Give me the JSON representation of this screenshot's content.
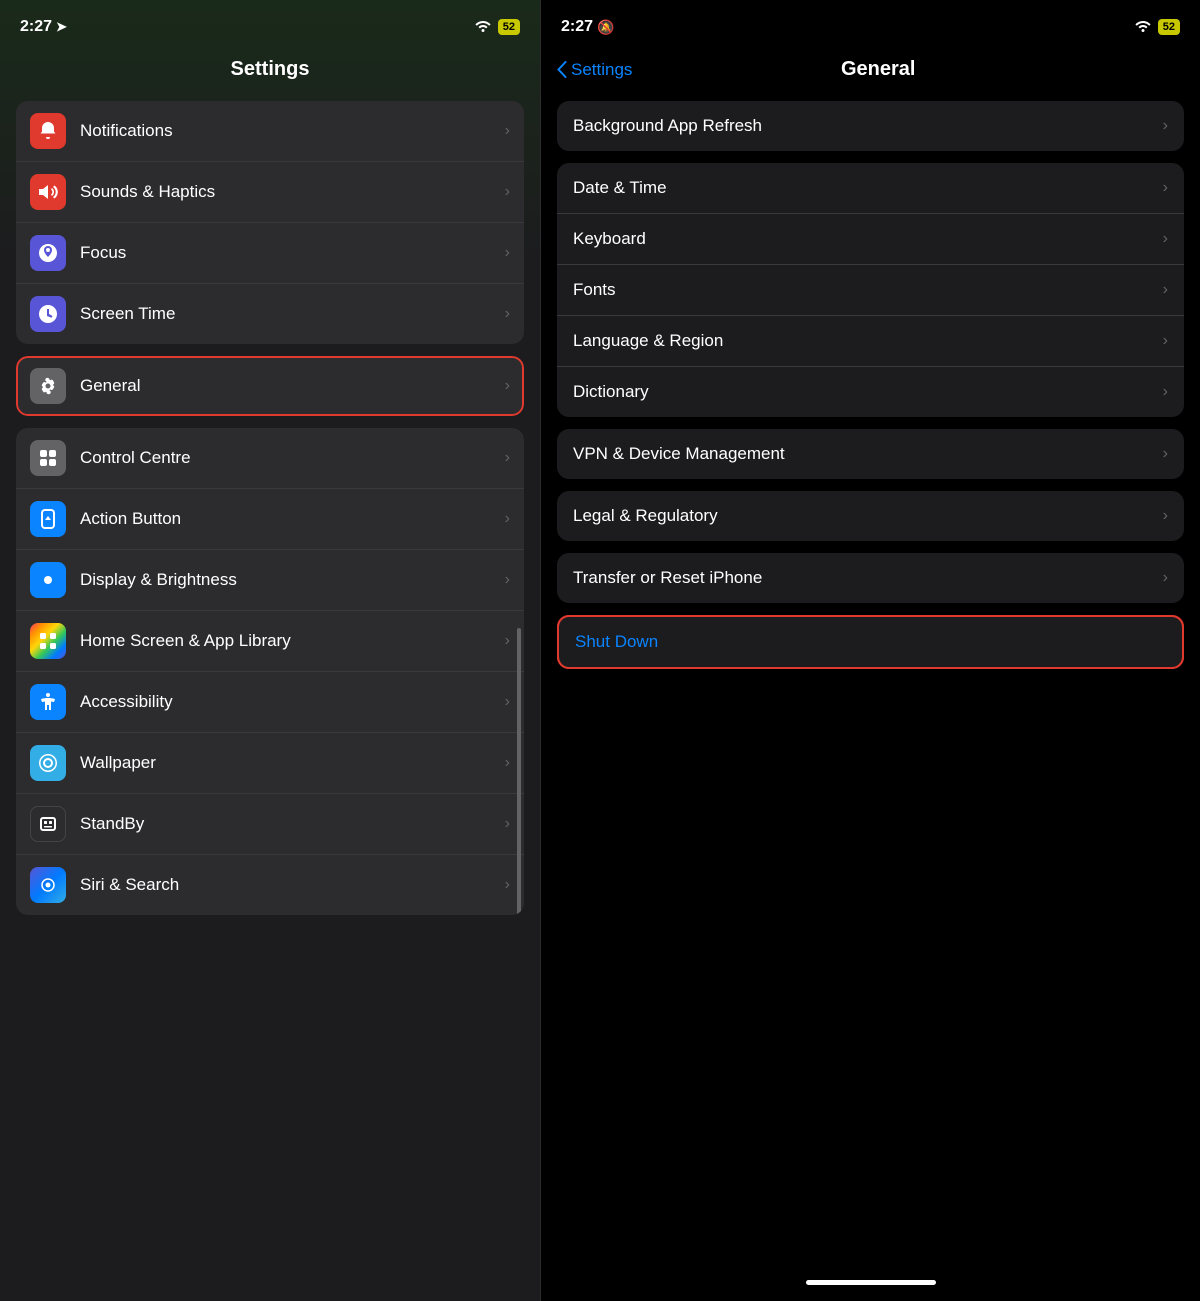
{
  "left": {
    "statusBar": {
      "time": "2:27",
      "wifi": "wifi",
      "battery": "52"
    },
    "title": "Settings",
    "groups": [
      {
        "id": "group1",
        "items": [
          {
            "id": "notifications",
            "label": "Notifications",
            "iconClass": "icon-red",
            "icon": "🔔"
          },
          {
            "id": "sounds",
            "label": "Sounds & Haptics",
            "iconClass": "icon-soundshaptics",
            "icon": "🔊"
          },
          {
            "id": "focus",
            "label": "Focus",
            "iconClass": "icon-indigo",
            "icon": "🌙"
          },
          {
            "id": "screen-time",
            "label": "Screen Time",
            "iconClass": "icon-indigo",
            "icon": "⏳"
          }
        ]
      },
      {
        "id": "group2",
        "items": [
          {
            "id": "general",
            "label": "General",
            "iconClass": "icon-gray",
            "icon": "⚙️",
            "highlighted": true
          }
        ]
      },
      {
        "id": "group3",
        "items": [
          {
            "id": "control-centre",
            "label": "Control Centre",
            "iconClass": "icon-gray",
            "icon": "☰"
          },
          {
            "id": "action-button",
            "label": "Action Button",
            "iconClass": "icon-blue",
            "icon": "↗"
          },
          {
            "id": "display-brightness",
            "label": "Display & Brightness",
            "iconClass": "icon-blue",
            "icon": "☀"
          },
          {
            "id": "home-screen",
            "label": "Home Screen & App Library",
            "iconClass": "icon-multicolor",
            "icon": "⊞"
          },
          {
            "id": "accessibility",
            "label": "Accessibility",
            "iconClass": "icon-blue",
            "icon": "♿"
          },
          {
            "id": "wallpaper",
            "label": "Wallpaper",
            "iconClass": "icon-teal",
            "icon": "❋"
          },
          {
            "id": "standby",
            "label": "StandBy",
            "iconClass": "icon-dark",
            "icon": "⊡"
          },
          {
            "id": "siri",
            "label": "Siri & Search",
            "iconClass": "icon-dark",
            "icon": "◉"
          }
        ]
      }
    ]
  },
  "right": {
    "statusBar": {
      "time": "2:27",
      "mute": "🔕",
      "wifi": "wifi",
      "battery": "52"
    },
    "backLabel": "Settings",
    "title": "General",
    "groups": [
      {
        "id": "rgroup1",
        "items": [
          {
            "id": "bg-refresh",
            "label": "Background App Refresh"
          }
        ]
      },
      {
        "id": "rgroup2",
        "items": [
          {
            "id": "date-time",
            "label": "Date & Time"
          },
          {
            "id": "keyboard",
            "label": "Keyboard"
          },
          {
            "id": "fonts",
            "label": "Fonts"
          },
          {
            "id": "language-region",
            "label": "Language & Region"
          },
          {
            "id": "dictionary",
            "label": "Dictionary"
          }
        ]
      },
      {
        "id": "rgroup3",
        "items": [
          {
            "id": "vpn",
            "label": "VPN & Device Management"
          }
        ]
      },
      {
        "id": "rgroup4",
        "items": [
          {
            "id": "legal",
            "label": "Legal & Regulatory"
          }
        ]
      },
      {
        "id": "rgroup5",
        "items": [
          {
            "id": "transfer-reset",
            "label": "Transfer or Reset iPhone"
          }
        ]
      },
      {
        "id": "rgroup6",
        "items": [
          {
            "id": "shut-down",
            "label": "Shut Down",
            "highlighted": true,
            "blue": true
          }
        ]
      }
    ]
  }
}
